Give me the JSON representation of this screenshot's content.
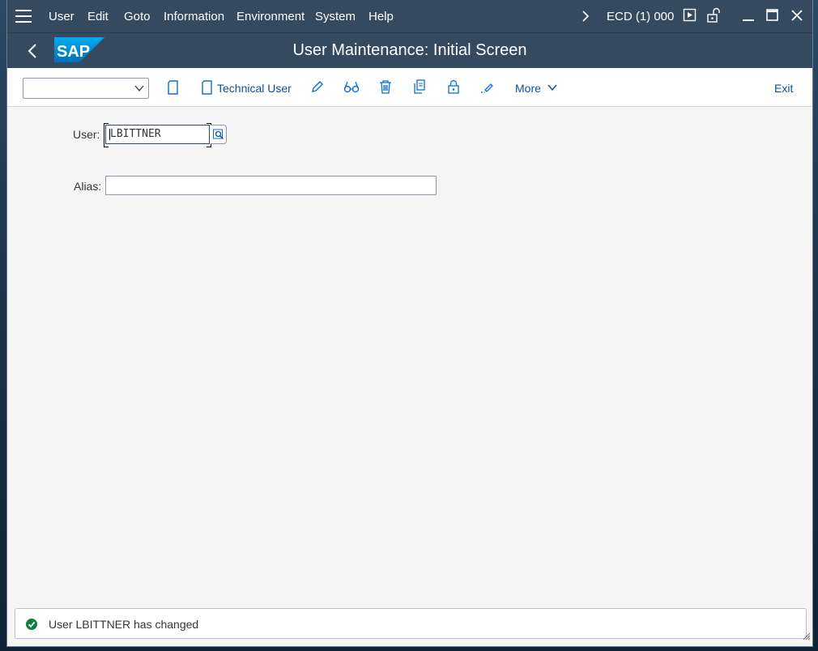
{
  "menubar": {
    "items": [
      {
        "label": "User"
      },
      {
        "label": "Edit"
      },
      {
        "label": "Goto"
      },
      {
        "label": "Information"
      },
      {
        "label": "Environment"
      },
      {
        "label": "System"
      },
      {
        "label": "Help"
      }
    ],
    "system_info": "ECD (1) 000"
  },
  "header": {
    "title": "User Maintenance: Initial Screen",
    "logo_text": "SAP"
  },
  "toolbar": {
    "command_field_value": "",
    "technical_user_label": "Technical User",
    "more_label": "More",
    "exit_label": "Exit"
  },
  "form": {
    "user_label": "User:",
    "user_value": "LBITTNER",
    "alias_label": "Alias:",
    "alias_value": ""
  },
  "status": {
    "type": "success",
    "message": "User LBITTNER has changed"
  },
  "colors": {
    "shell": "#354a5f",
    "accent": "#0a6ed1",
    "success": "#107e3e"
  }
}
